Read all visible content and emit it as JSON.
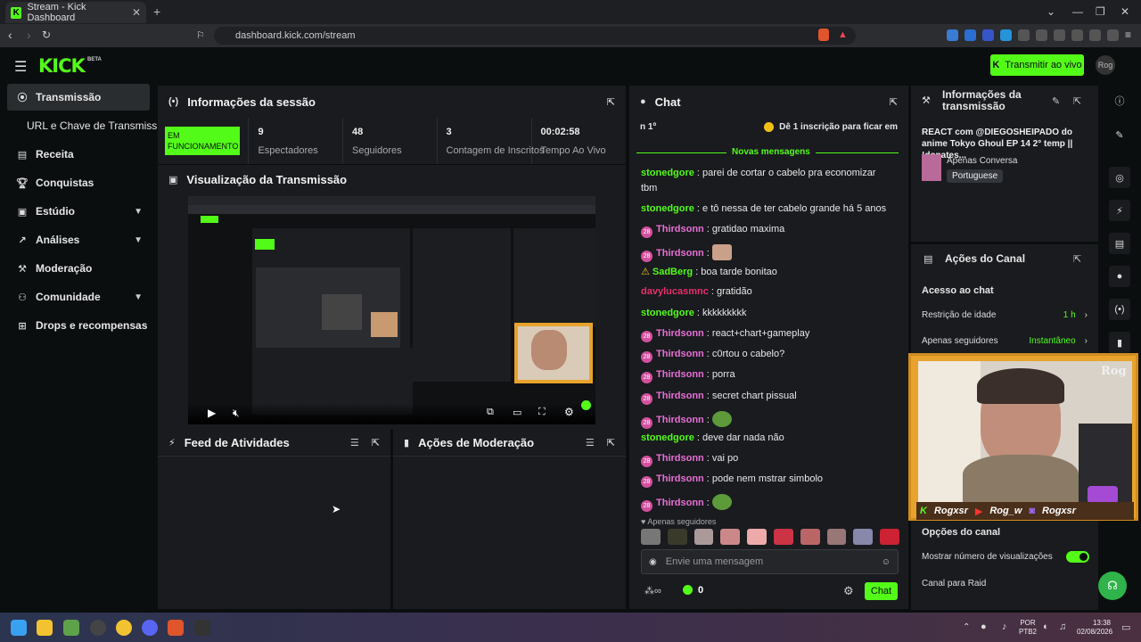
{
  "browser": {
    "tab_title": "Stream - Kick Dashboard",
    "url": "dashboard.kick.com/stream"
  },
  "header": {
    "logo": "KICK",
    "logo_badge": "BETA",
    "go_live": "Transmitir ao vivo"
  },
  "sidebar": {
    "items": [
      {
        "label": "Transmissão"
      },
      {
        "label": "URL e Chave de Transmissão"
      },
      {
        "label": "Receita"
      },
      {
        "label": "Conquistas"
      },
      {
        "label": "Estúdio"
      },
      {
        "label": "Análises"
      },
      {
        "label": "Moderação"
      },
      {
        "label": "Comunidade"
      },
      {
        "label": "Drops e recompensas"
      }
    ]
  },
  "session": {
    "title": "Informações da sessão",
    "status": "EM FUNCIONAMENTO",
    "stats": [
      {
        "value": "9",
        "label": "Espectadores"
      },
      {
        "value": "48",
        "label": "Seguidores"
      },
      {
        "value": "3",
        "label": "Contagem de Inscritos"
      },
      {
        "value": "00:02:58",
        "label": "Tempo Ao Vivo"
      }
    ]
  },
  "preview": {
    "title": "Visualização da Transmissão"
  },
  "activity": {
    "title": "Feed de Atividades"
  },
  "mod_actions": {
    "title": "Ações de Moderação"
  },
  "chat": {
    "title": "Chat",
    "pinned_count": "n 1º",
    "pinned_text": "Dê 1 inscrição para ficar em",
    "new_messages": "Novas mensagens",
    "messages": [
      {
        "user": "stonedgore",
        "text": "parei de cortar o cabelo pra economizar",
        "color": "#53fc18"
      },
      {
        "user": "",
        "text": "tbm",
        "color": "#53fc18"
      },
      {
        "user": "stonedgore",
        "text": "e tô nessa de ter cabelo grande há 5 anos",
        "color": "#53fc18"
      },
      {
        "user": "Thirdsonn",
        "text": "gratidao maxima",
        "color": "#e86fd4"
      },
      {
        "user": "Thirdsonn",
        "text": "",
        "color": "#e86fd4"
      },
      {
        "user": "SadBerg",
        "text": "boa tarde bonitao",
        "color": "#53fc18"
      },
      {
        "user": "davylucasmnc",
        "text": "gratidão",
        "color": "#e8306a"
      },
      {
        "user": "stonedgore",
        "text": "kkkkkkkkk",
        "color": "#53fc18"
      },
      {
        "user": "Thirdsonn",
        "text": "react+chart+gameplay",
        "color": "#e86fd4"
      },
      {
        "user": "Thirdsonn",
        "text": "c0rtou o cabelo?",
        "color": "#e86fd4"
      },
      {
        "user": "Thirdsonn",
        "text": "porra",
        "color": "#e86fd4"
      },
      {
        "user": "Thirdsonn",
        "text": "secret chart pissual",
        "color": "#e86fd4"
      },
      {
        "user": "Thirdsonn",
        "text": "",
        "color": "#e86fd4"
      },
      {
        "user": "stonedgore",
        "text": "deve dar nada não",
        "color": "#53fc18"
      },
      {
        "user": "Thirdsonn",
        "text": "vai po",
        "color": "#e86fd4"
      },
      {
        "user": "Thirdsonn",
        "text": "pode nem mstrar simbolo",
        "color": "#e86fd4"
      },
      {
        "user": "Thirdsonn",
        "text": "",
        "color": "#e86fd4"
      }
    ],
    "followers_only": "Apenas seguidores",
    "input_placeholder": "Envie uma mensagem",
    "points": "0",
    "send_label": "Chat"
  },
  "stream_info": {
    "title": "Informações da transmissão",
    "stream_title": "REACT com @DIEGOSHEIPADO do anime Tokyo Ghoul EP 14 2° temp || !donates...",
    "category": "Apenas Conversa",
    "language": "Portuguese"
  },
  "channel_actions": {
    "title": "Ações do Canal",
    "chat_access": "Acesso ao chat",
    "age_restriction": "Restrição de idade",
    "age_value": "1 h",
    "followers_only": "Apenas seguidores",
    "followers_value": "Instantâneo",
    "channel_options": "Opções do canal",
    "show_views": "Mostrar número de visualizações",
    "raid": "Canal para Raid"
  },
  "webcam": {
    "socials": [
      "Rogxsr",
      "Rog_w",
      "Rogxsr"
    ]
  },
  "taskbar": {
    "lang": "POR",
    "lang2": "PTB2",
    "time": "13:38",
    "date": "02/08/2026"
  },
  "colors": {
    "accent": "#53fc18",
    "panel": "#191b1f",
    "background": "#0b0e0f",
    "sub_badge": "#d4509f"
  }
}
